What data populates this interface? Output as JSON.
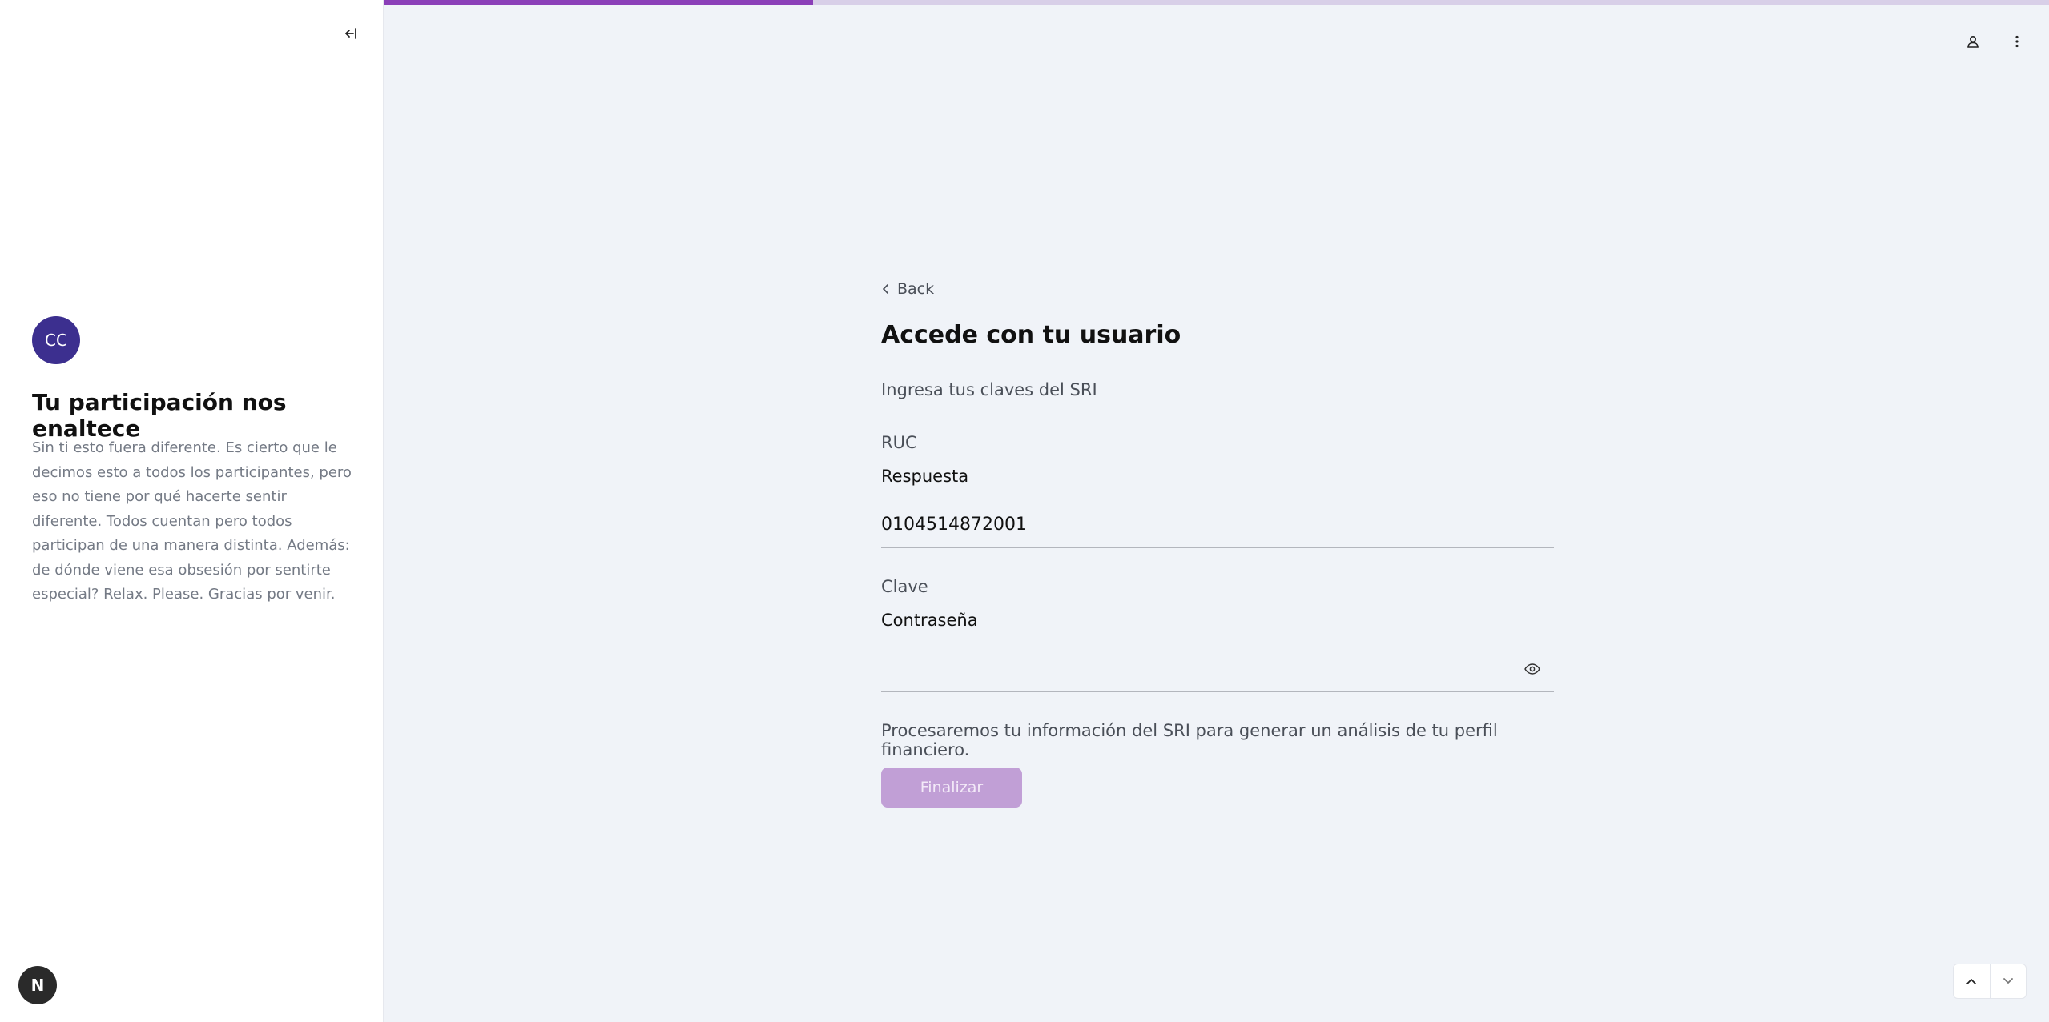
{
  "sidebar": {
    "avatar_initials": "CC",
    "title": "Tu participación nos enaltece",
    "description": "Sin ti esto fuera diferente. Es cierto que le decimos esto a todos los participantes, pero eso no tiene por qué hacerte sentir diferente. Todos cuentan pero todos participan de una manera distinta. Además: de dónde viene esa obsesión por sentirte especial? Relax. Please. Gracias por venir.",
    "badge": "N",
    "collapse_icon": "collapse-left-icon"
  },
  "progress": {
    "fraction": 0.258,
    "color": "#8b3fb8",
    "track_color": "#d8cfe8"
  },
  "header": {
    "icons": [
      "user-icon",
      "more-vertical-icon"
    ]
  },
  "form": {
    "back_label": "Back",
    "title": "Accede con tu usuario",
    "subtitle": "Ingresa tus claves del SRI",
    "ruc": {
      "label": "RUC",
      "sublabel": "Respuesta",
      "value": "0104514872001"
    },
    "clave": {
      "label": "Clave",
      "sublabel": "Contraseña",
      "value": ""
    },
    "note": "Procesaremos tu información del SRI para generar un análisis de tu perfil financiero.",
    "submit_label": "Finalizar"
  },
  "colors": {
    "accent": "#8b3fb8",
    "button_disabled": "#c19fd6",
    "avatar": "#3c2f8f",
    "background": "#f0f3f8"
  }
}
